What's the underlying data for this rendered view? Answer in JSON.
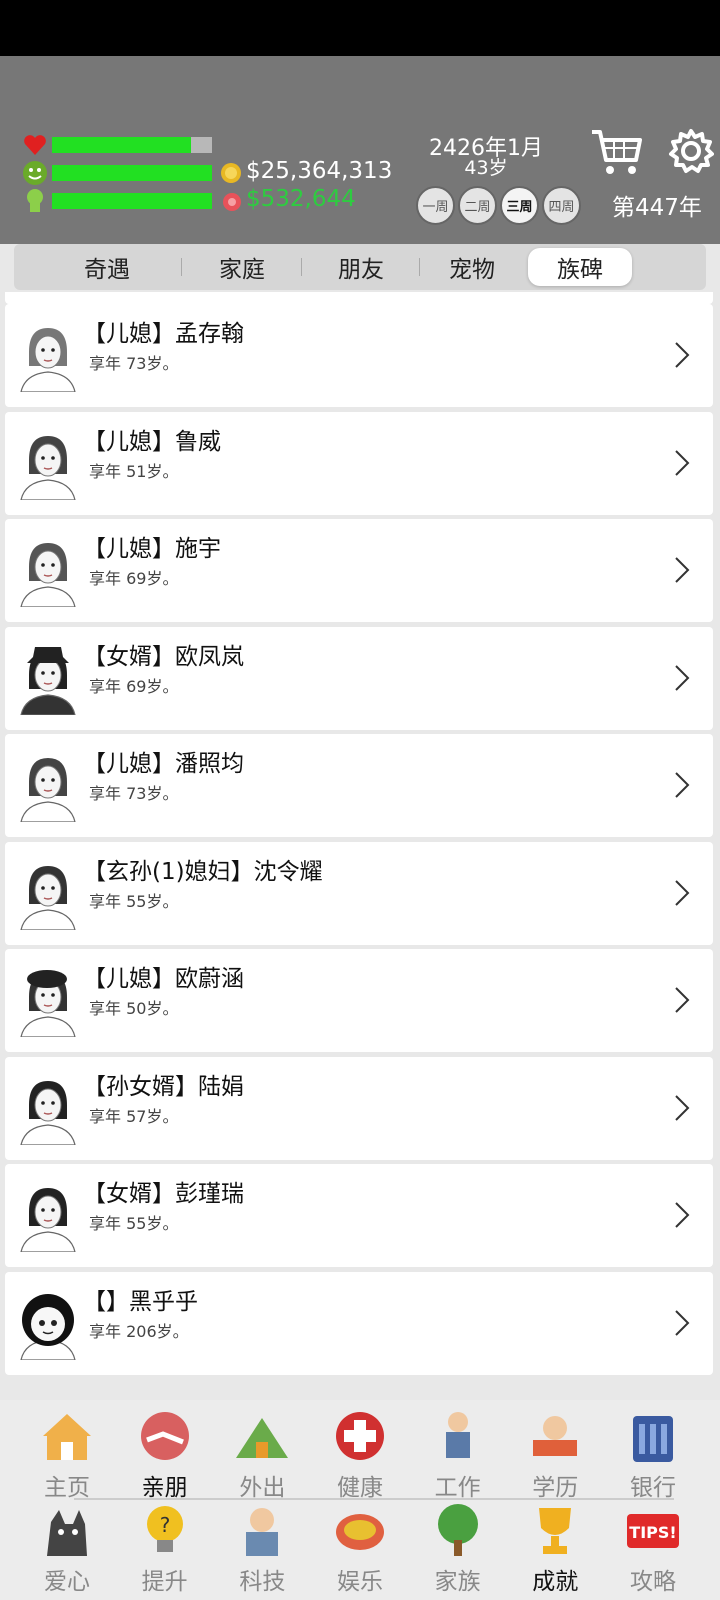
{
  "header": {
    "money": "$25,364,313",
    "income": "$532,644",
    "date": "2426年1月",
    "age": "43岁",
    "year": "第447年",
    "weeks": [
      "一周",
      "二周",
      "三周",
      "四周"
    ],
    "active_week": 2,
    "bars": {
      "heart": 0.87,
      "mood": 1.0,
      "smart": 1.0
    }
  },
  "tabs": [
    "奇遇",
    "家庭",
    "朋友",
    "宠物",
    "族碑"
  ],
  "active_tab": 4,
  "graves": [
    {
      "name": "【儿媳】孟存翰",
      "sub": "享年 73岁。"
    },
    {
      "name": "【儿媳】鲁威",
      "sub": "享年 51岁。"
    },
    {
      "name": "【儿媳】施宇",
      "sub": "享年 69岁。"
    },
    {
      "name": "【女婿】欧凤岚",
      "sub": "享年 69岁。"
    },
    {
      "name": "【儿媳】潘照均",
      "sub": "享年 73岁。"
    },
    {
      "name": "【玄孙(1)媳妇】沈令耀",
      "sub": "享年 55岁。"
    },
    {
      "name": "【儿媳】欧蔚涵",
      "sub": "享年 50岁。"
    },
    {
      "name": "【孙女婿】陆娟",
      "sub": "享年 57岁。"
    },
    {
      "name": "【女婿】彭瑾瑞",
      "sub": "享年 55岁。"
    },
    {
      "name": "【】黑乎乎",
      "sub": "享年 206岁。"
    }
  ],
  "nav_row1": [
    "主页",
    "亲朋",
    "外出",
    "健康",
    "工作",
    "学历",
    "银行"
  ],
  "nav_row2": [
    "爱心",
    "提升",
    "科技",
    "娱乐",
    "家族",
    "成就",
    "攻略"
  ],
  "colors": {
    "bar_fill": "#22e022",
    "income": "#2ecc40",
    "header_bg": "#777777"
  }
}
